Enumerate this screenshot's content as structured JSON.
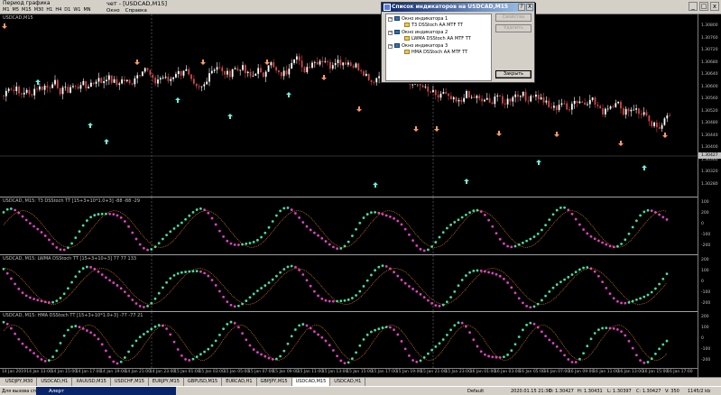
{
  "period_bar": {
    "title": "Период графика",
    "timeframes": [
      "M1",
      "M5",
      "M15",
      "M30",
      "H1",
      "H4",
      "D1",
      "W1",
      "MN"
    ]
  },
  "menu_strip": {
    "doc_title": "чет - [USDCAD,M15]",
    "items": [
      "Окно",
      "Справка"
    ]
  },
  "mdi_buttons": [
    "_",
    "□",
    "x"
  ],
  "dialog": {
    "title": "Список индикаторов на USDCAD,M15",
    "help_button": "?",
    "close_button": "X",
    "tree": [
      {
        "window": "Окно индикатора 1",
        "indicator": "T3 DSStoch AA MTF TT"
      },
      {
        "window": "Окно индикатора 2",
        "indicator": "LWMA DSStoch AA MTF TT"
      },
      {
        "window": "Окно индикатора 3",
        "indicator": "HMA DSStoch AA MTF TT"
      }
    ],
    "expand_glyph": "−",
    "buttons": {
      "properties": "Свойства",
      "delete": "Удалить",
      "close": "Закрыть"
    }
  },
  "chart": {
    "symbol_label": "USDCAD,M15",
    "pane1_label": "USDCAD, M15: T3 DSStoch TT [15+3+10*1.0+3]  -88 -88 -29",
    "pane2_label": "USDCAD, M15: LWMA DSStoch TT [15+3+10+3]  77 77 133",
    "pane3_label": "USDCAD, M15: HMA DSStoch TT [15+3+10*1.0+3]  -77 -77 21",
    "price_labels": [
      "1.30800",
      "1.30760",
      "1.30720",
      "1.30680",
      "1.30640",
      "1.30600",
      "1.30560",
      "1.30520",
      "1.30480",
      "1.30440",
      "1.30400",
      "1.30360",
      "1.30320",
      "1.30280"
    ],
    "current_price": "1.30427",
    "osc_labels_top": [
      "100",
      "200",
      "0",
      "-100",
      "-200"
    ],
    "osc_labels_mid": [
      "200",
      "100",
      "0",
      "-100",
      "-200"
    ],
    "osc_labels_bot": [
      "200",
      "100",
      "0",
      "-100",
      "-200"
    ],
    "time_labels": [
      "14 Jan 2019",
      "14 Jan 13:00",
      "14 Jan 15:00",
      "14 Jan 17:00",
      "14 Jan 19:00",
      "14 Jan 21:00",
      "14 Jan 23:00",
      "15 Jan 01:00",
      "15 Jan 03:00",
      "15 Jan 05:00",
      "15 Jan 07:00",
      "15 Jan 09:00",
      "15 Jan 11:00",
      "15 Jan 13:00",
      "15 Jan 15:00",
      "15 Jan 17:00",
      "15 Jan 19:00",
      "15 Jan 21:00",
      "15 Jan 23:00",
      "16 Jan 01:00",
      "16 Jan 03:00",
      "16 Jan 05:00",
      "16 Jan 07:00",
      "16 Jan 09:00",
      "16 Jan 11:00",
      "16 Jan 13:00",
      "16 Jan 15:00",
      "16 Jan 17:00"
    ],
    "colors": {
      "bull_candle": "#ffffff",
      "bear_candle": "#d04848",
      "up_arrow": "#6ef0d8",
      "down_arrow": "#ff9a60",
      "osc_up": "#40e0a0",
      "osc_down": "#e040c0",
      "signal": "#ff9020"
    }
  },
  "tabs": [
    "USDJPY,M30",
    "USDCAD,H1",
    "XAUUSD,M15",
    "USDCHF,M15",
    "EURJPY,M15",
    "GBPUSD,M15",
    "EURCAD,H1",
    "GBPJPY,M15",
    "USDCAD,M15",
    "USDCAD,H1"
  ],
  "active_tab": "USDCAD,M15",
  "status": {
    "help_hint": "Для вызова спра",
    "taskbar": "Алерт",
    "profile": "Default",
    "datetime": "2020.01.15 21:30",
    "open": "O: 1.30427",
    "high": "H: 1.30431",
    "low": "L: 1.30397",
    "close": "C: 1.30427",
    "volume": "V: 350",
    "traffic": "1145/2 kb"
  }
}
